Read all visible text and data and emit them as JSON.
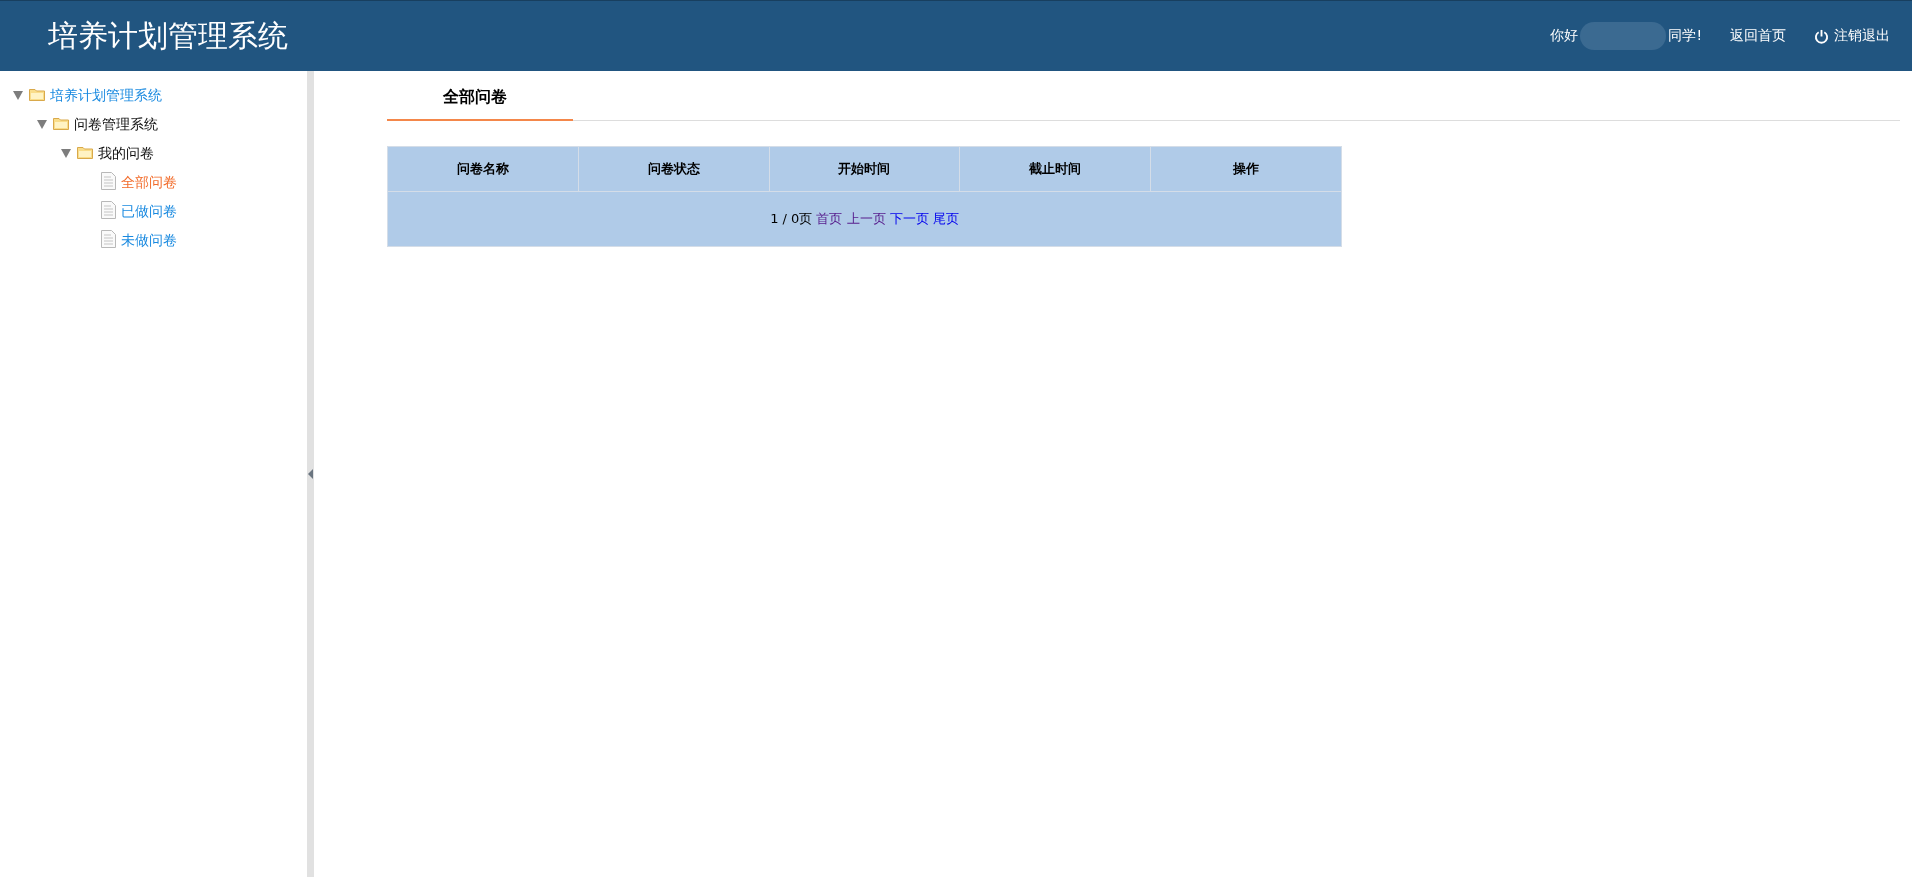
{
  "header": {
    "title": "培养计划管理系统",
    "greeting_before": "你好",
    "greeting_after": "同学!",
    "home_link": "返回首页",
    "logout_link": "注销退出"
  },
  "sidebar": {
    "tree": [
      {
        "label": "培养计划管理系统",
        "kind": "folder",
        "link": true,
        "expanded": true,
        "selected": false,
        "children": [
          {
            "label": "问卷管理系统",
            "kind": "folder",
            "link": false,
            "expanded": true,
            "selected": false,
            "children": [
              {
                "label": "我的问卷",
                "kind": "folder",
                "link": false,
                "expanded": true,
                "selected": false,
                "children": [
                  {
                    "label": "全部问卷",
                    "kind": "file",
                    "selected": true
                  },
                  {
                    "label": "已做问卷",
                    "kind": "file",
                    "link": true,
                    "selected": false
                  },
                  {
                    "label": "未做问卷",
                    "kind": "file",
                    "link": true,
                    "selected": false
                  }
                ]
              }
            ]
          }
        ]
      }
    ]
  },
  "main": {
    "tab": "全部问卷",
    "table": {
      "columns": [
        "问卷名称",
        "问卷状态",
        "开始时间",
        "截止时间",
        "操作"
      ],
      "pager": {
        "status": "1 / 0页",
        "links": [
          {
            "label": "首页",
            "visited": true
          },
          {
            "label": "上一页",
            "visited": true
          },
          {
            "label": "下一页",
            "visited": false
          },
          {
            "label": "尾页",
            "visited": false
          }
        ]
      }
    }
  }
}
